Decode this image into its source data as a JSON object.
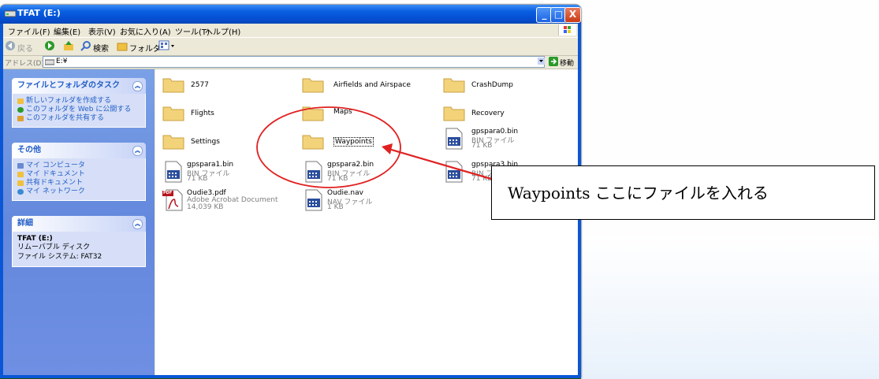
{
  "window": {
    "title": "TFAT (E:)",
    "buttons": {
      "minimize": "_",
      "maximize": "□",
      "close": "X"
    }
  },
  "menu": [
    "ファイル(F)",
    "編集(E)",
    "表示(V)",
    "お気に入り(A)",
    "ツール(T)",
    "ヘルプ(H)"
  ],
  "toolbar": {
    "back": "戻る",
    "search": "検索",
    "folders": "フォルダ"
  },
  "address": {
    "label": "アドレス(D)",
    "value": "E:¥",
    "go": "移動"
  },
  "tasks": {
    "header": "ファイルとフォルダのタスク",
    "items": [
      "新しいフォルダを作成する",
      "このフォルダを Web に公開する",
      "このフォルダを共有する"
    ]
  },
  "other": {
    "header": "その他",
    "items": [
      "マイ コンピュータ",
      "マイ ドキュメント",
      "共有ドキュメント",
      "マイ ネットワーク"
    ]
  },
  "details": {
    "header": "詳細",
    "name": "TFAT (E:)",
    "type": "リムーバブル ディスク",
    "fs": "ファイル システム: FAT32"
  },
  "files": [
    {
      "name": "2577"
    },
    {
      "name": "Airfields and Airspace"
    },
    {
      "name": "CrashDump"
    },
    {
      "name": "Flights"
    },
    {
      "name": "Maps"
    },
    {
      "name": "Recovery"
    },
    {
      "name": "Settings"
    },
    {
      "name": "Waypoints"
    },
    {
      "name": "gpspara0.bin",
      "type": "BIN ファイル",
      "size": "71 KB"
    },
    {
      "name": "gpspara1.bin",
      "type": "BIN ファイル",
      "size": "71 KB"
    },
    {
      "name": "gpspara2.bin",
      "type": "BIN ファイル",
      "size": "71 KB"
    },
    {
      "name": "gpspara3.bin",
      "type": "BIN ファイル",
      "size": "71 KB"
    },
    {
      "name": "Oudie3.pdf",
      "type": "Adobe Acrobat Document",
      "size": "14,039 KB",
      "badge": "PDF"
    },
    {
      "name": "Oudie.nav",
      "type": "NAV ファイル",
      "size": "1 KB"
    }
  ],
  "annotation": {
    "text": "Waypoints ここにファイルを入れる",
    "color": "#e02020"
  }
}
